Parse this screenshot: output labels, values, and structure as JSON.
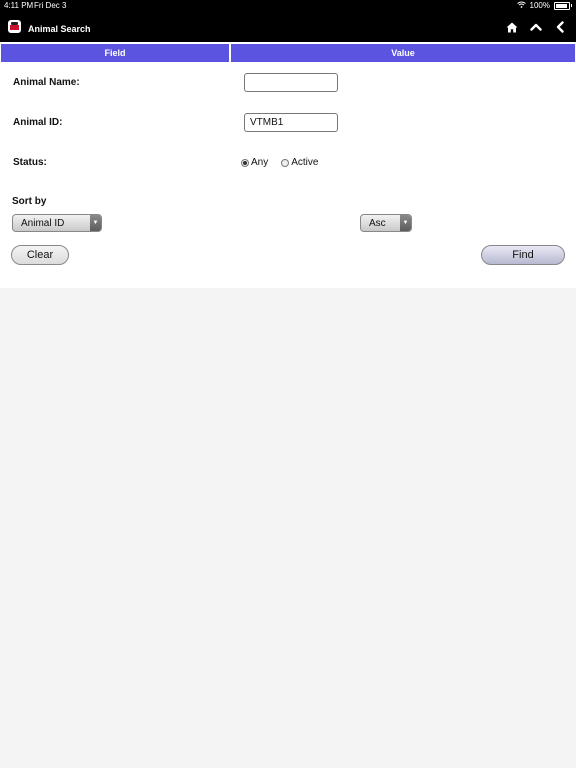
{
  "status_bar": {
    "time": "4:11 PM",
    "date": "Fri Dec 3",
    "battery": "100%"
  },
  "app": {
    "title": "Animal Search"
  },
  "icons": {
    "app": "app-logo-icon",
    "home": "home-icon",
    "up": "chevron-up-icon",
    "back": "chevron-left-icon"
  },
  "table": {
    "col_field": "Field",
    "col_value": "Value"
  },
  "form": {
    "animal_name": {
      "label": "Animal Name:",
      "value": ""
    },
    "animal_id": {
      "label": "Animal ID:",
      "value": "VTMB1"
    },
    "status": {
      "label": "Status:",
      "options": [
        "Any",
        "Active"
      ],
      "selected": "Any"
    }
  },
  "sort": {
    "label": "Sort by",
    "field": "Animal ID",
    "order": "Asc"
  },
  "buttons": {
    "clear": "Clear",
    "find": "Find"
  },
  "colors": {
    "header": "#5b54e0",
    "topbar": "#000000",
    "background": "#f4f4f4"
  }
}
